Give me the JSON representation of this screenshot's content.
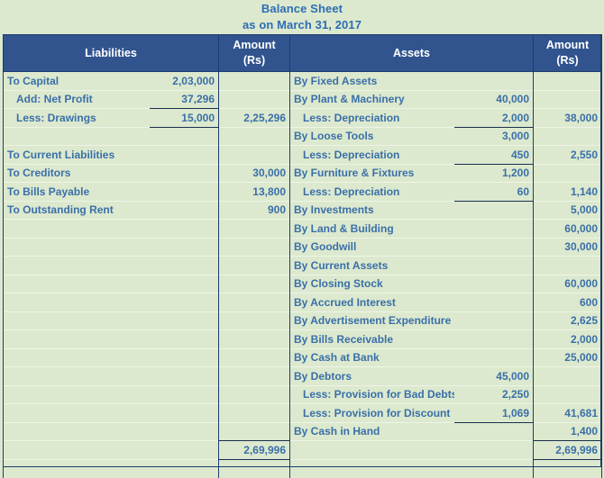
{
  "title": {
    "line1": "Balance Sheet",
    "line2": "as on March 31, 2017"
  },
  "colors": {
    "header_bg": "#31548f",
    "header_text": "#ffffff",
    "page_bg": "#dce9ce",
    "body_text": "#3a6fa8",
    "title_text": "#2e6db4",
    "rule": "#1a3050"
  },
  "headers": {
    "liabilities": "Liabilities",
    "amount_left_line1": "Amount",
    "amount_left_line2": "(Rs)",
    "assets": "Assets",
    "amount_right_line1": "Amount",
    "amount_right_line2": "(Rs)"
  },
  "liabilities_rows": [
    {
      "label": "To Capital",
      "sub": "2,03,000",
      "amount": ""
    },
    {
      "label": "Add: Net Profit",
      "sub": "37,296",
      "amount": ""
    },
    {
      "label": "Less: Drawings",
      "sub": "15,000",
      "amount": "2,25,296"
    },
    {
      "label": "",
      "sub": "",
      "amount": ""
    },
    {
      "label": "To Current Liabilities",
      "sub": "",
      "amount": ""
    },
    {
      "label": "To Creditors",
      "sub": "",
      "amount": "30,000"
    },
    {
      "label": "To Bills Payable",
      "sub": "",
      "amount": "13,800"
    },
    {
      "label": "To Outstanding Rent",
      "sub": "",
      "amount": "900"
    },
    {
      "label": "",
      "sub": "",
      "amount": ""
    },
    {
      "label": "",
      "sub": "",
      "amount": ""
    },
    {
      "label": "",
      "sub": "",
      "amount": ""
    },
    {
      "label": "",
      "sub": "",
      "amount": ""
    },
    {
      "label": "",
      "sub": "",
      "amount": ""
    },
    {
      "label": "",
      "sub": "",
      "amount": ""
    },
    {
      "label": "",
      "sub": "",
      "amount": ""
    },
    {
      "label": "",
      "sub": "",
      "amount": ""
    },
    {
      "label": "",
      "sub": "",
      "amount": ""
    },
    {
      "label": "",
      "sub": "",
      "amount": ""
    },
    {
      "label": "",
      "sub": "",
      "amount": ""
    },
    {
      "label": "",
      "sub": "",
      "amount": ""
    }
  ],
  "assets_rows": [
    {
      "label": "By Fixed Assets",
      "sub": "",
      "amount": ""
    },
    {
      "label": "By Plant & Machinery",
      "sub": "40,000",
      "amount": ""
    },
    {
      "label": "Less: Depreciation",
      "sub": "2,000",
      "amount": "38,000"
    },
    {
      "label": "By Loose Tools",
      "sub": "3,000",
      "amount": ""
    },
    {
      "label": "Less: Depreciation",
      "sub": "450",
      "amount": "2,550"
    },
    {
      "label": "By Furniture & Fixtures",
      "sub": "1,200",
      "amount": ""
    },
    {
      "label": "Less: Depreciation",
      "sub": "60",
      "amount": "1,140"
    },
    {
      "label": "By Investments",
      "sub": "",
      "amount": "5,000"
    },
    {
      "label": "By Land & Building",
      "sub": "",
      "amount": "60,000"
    },
    {
      "label": "By Goodwill",
      "sub": "",
      "amount": "30,000"
    },
    {
      "label": "By Current Assets",
      "sub": "",
      "amount": ""
    },
    {
      "label": "By Closing Stock",
      "sub": "",
      "amount": "60,000"
    },
    {
      "label": "By Accrued Interest",
      "sub": "",
      "amount": "600"
    },
    {
      "label": "By Advertisement Expenditure",
      "sub": "",
      "amount": "2,625"
    },
    {
      "label": "By Bills Receivable",
      "sub": "",
      "amount": "2,000"
    },
    {
      "label": "By Cash at Bank",
      "sub": "",
      "amount": "25,000"
    },
    {
      "label": "By Debtors",
      "sub": "45,000",
      "amount": ""
    },
    {
      "label": "Less: Provision for Bad Debts",
      "sub": "2,250",
      "amount": ""
    },
    {
      "label": "Less: Provision for Discount",
      "sub": "1,069",
      "amount": "41,681"
    },
    {
      "label": "By Cash in Hand",
      "sub": "",
      "amount": "1,400"
    }
  ],
  "totals": {
    "liabilities_total": "2,69,996",
    "assets_total": "2,69,996"
  }
}
